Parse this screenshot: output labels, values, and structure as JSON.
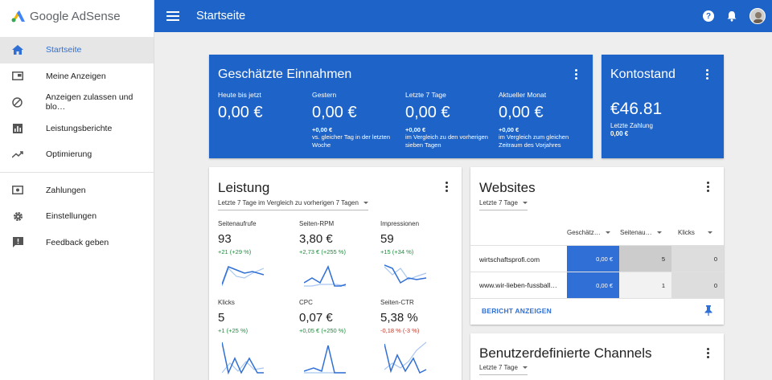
{
  "app": {
    "logo_text": "Google AdSense",
    "page_title": "Startseite"
  },
  "sidebar": {
    "items": [
      {
        "label": "Startseite",
        "icon": "home-icon"
      },
      {
        "label": "Meine Anzeigen",
        "icon": "ad-unit-icon"
      },
      {
        "label": "Anzeigen zulassen und blo…",
        "icon": "block-icon"
      },
      {
        "label": "Leistungsberichte",
        "icon": "bar-chart-icon"
      },
      {
        "label": "Optimierung",
        "icon": "trending-up-icon"
      },
      {
        "label": "Zahlungen",
        "icon": "payment-icon"
      },
      {
        "label": "Einstellungen",
        "icon": "gear-icon"
      },
      {
        "label": "Feedback geben",
        "icon": "feedback-icon"
      }
    ]
  },
  "topbar": {
    "help_glyph": "?"
  },
  "earnings": {
    "title": "Geschätzte Einnahmen",
    "columns": [
      {
        "label": "Heute bis jetzt",
        "value": "0,00 €",
        "delta": "",
        "note": ""
      },
      {
        "label": "Gestern",
        "value": "0,00 €",
        "delta": "+0,00 €",
        "note": "vs. gleicher Tag in der letzten Woche"
      },
      {
        "label": "Letzte 7 Tage",
        "value": "0,00 €",
        "delta": "+0,00 €",
        "note": "im Vergleich zu den vorherigen sieben Tagen"
      },
      {
        "label": "Aktueller Monat",
        "value": "0,00 €",
        "delta": "+0,00 €",
        "note": "im Vergleich zum gleichen Zeitraum des Vorjahres"
      }
    ]
  },
  "balance": {
    "title": "Kontostand",
    "amount": "€46.81",
    "last_payment_label": "Letzte Zahlung",
    "last_payment_value": "0,00 €"
  },
  "performance": {
    "title": "Leistung",
    "range": "Letzte 7 Tage im Vergleich zu vorherigen 7 Tagen",
    "metrics": [
      {
        "label": "Seitenaufrufe",
        "value": "93",
        "delta": "+21 (+29 %)",
        "sign": "pos"
      },
      {
        "label": "Seiten-RPM",
        "value": "3,80 €",
        "delta": "+2,73 € (+255 %)",
        "sign": "pos"
      },
      {
        "label": "Impressionen",
        "value": "59",
        "delta": "+15 (+34 %)",
        "sign": "pos"
      },
      {
        "label": "Klicks",
        "value": "5",
        "delta": "+1 (+25 %)",
        "sign": "pos"
      },
      {
        "label": "CPC",
        "value": "0,07 €",
        "delta": "+0,05 € (+250 %)",
        "sign": "pos"
      },
      {
        "label": "Seiten-CTR",
        "value": "5,38 %",
        "delta": "-0,18 % (-3 %)",
        "sign": "neg"
      }
    ]
  },
  "websites": {
    "title": "Websites",
    "range": "Letzte 7 Tage",
    "headers": [
      "Geschätz…",
      "Seitenau…",
      "Klicks"
    ],
    "rows": [
      {
        "site": "wirtschaftsprofi.com",
        "earnings": "0,00 €",
        "pageviews": "5",
        "clicks": "0"
      },
      {
        "site": "www.wir-lieben-fussball…",
        "earnings": "0,00 €",
        "pageviews": "1",
        "clicks": "0"
      }
    ],
    "report_button": "BERICHT ANZEIGEN"
  },
  "channels": {
    "title": "Benutzerdefinierte Channels",
    "range": "Letzte 7 Tage"
  },
  "colors": {
    "primary": "#1e64c8",
    "accent_blue": "#2f6fd6",
    "positive": "#1a8f3c",
    "negative": "#c0392b",
    "table_highlight": "#2f6fd6"
  }
}
